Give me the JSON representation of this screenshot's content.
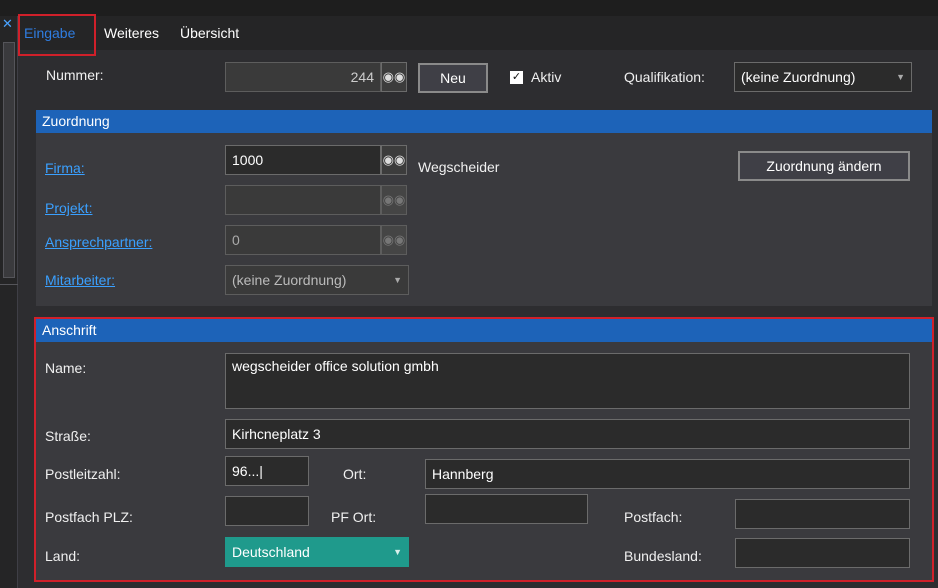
{
  "tabs": {
    "eingabe": "Eingabe",
    "weiteres": "Weiteres",
    "uebersicht": "Übersicht"
  },
  "header": {
    "nummer_label": "Nummer:",
    "nummer_value": "244",
    "neu_button": "Neu",
    "aktiv_label": "Aktiv",
    "qualifikation_label": "Qualifikation:",
    "qualifikation_value": "(keine Zuordnung)"
  },
  "zuordnung": {
    "title": "Zuordnung",
    "firma_label": "Firma:",
    "firma_value": "1000",
    "firma_name": "Wegscheider",
    "projekt_label": "Projekt:",
    "projekt_value": "",
    "ansprechpartner_label": "Ansprechpartner:",
    "ansprechpartner_value": "0",
    "mitarbeiter_label": "Mitarbeiter:",
    "mitarbeiter_value": "(keine Zuordnung)",
    "change_button": "Zuordnung ändern"
  },
  "anschrift": {
    "title": "Anschrift",
    "name_label": "Name:",
    "name_value": "wegscheider office solution gmbh",
    "strasse_label": "Straße:",
    "strasse_value": "Kirhcneplatz 3",
    "plz_label": "Postleitzahl:",
    "plz_value": "96...|",
    "ort_label": "Ort:",
    "ort_value": "Hannberg",
    "postfach_plz_label": "Postfach PLZ:",
    "postfach_plz_value": "",
    "pf_ort_label": "PF Ort:",
    "pf_ort_value": "",
    "postfach_label": "Postfach:",
    "postfach_value": "",
    "land_label": "Land:",
    "land_value": "Deutschland",
    "bundesland_label": "Bundesland:",
    "bundesland_value": ""
  },
  "icons": {
    "lookup": "binoculars-icon",
    "close": "close-icon",
    "dropdown": "chevron-down-icon"
  },
  "colors": {
    "accent": "#1d63b8",
    "highlight": "#d0202a",
    "land_bg": "#1f9a8c",
    "link": "#3aa0ff"
  }
}
